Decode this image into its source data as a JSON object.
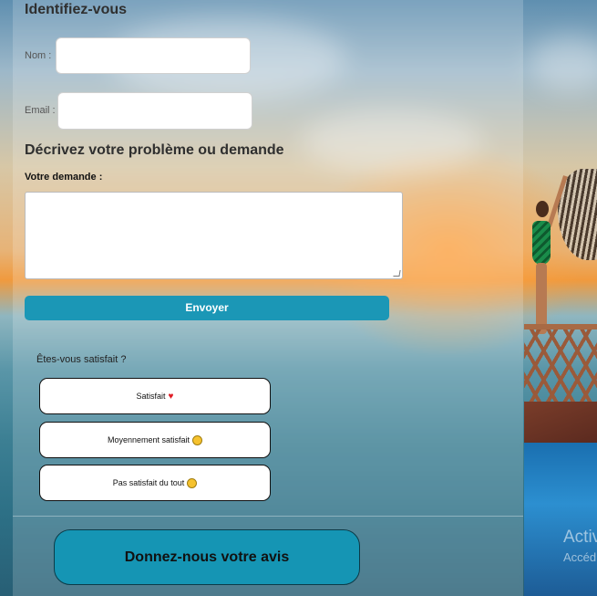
{
  "identify": {
    "title": "Identifiez-vous",
    "name_label": "Nom :",
    "email_label": "Email :",
    "name_value": "",
    "email_value": ""
  },
  "request": {
    "title": "Décrivez votre problème ou demande",
    "label": "Votre demande :",
    "value": "",
    "submit_label": "Envoyer"
  },
  "satisfaction": {
    "question": "Êtes-vous satisfait ?",
    "options": [
      {
        "label": "Satisfait",
        "emoji": "heart-icon"
      },
      {
        "label": "Moyennement satisfait",
        "emoji": "neutral-face-icon"
      },
      {
        "label": "Pas satisfait du tout",
        "emoji": "sad-face-icon"
      }
    ]
  },
  "cta": {
    "label": "Donnez-nous votre avis"
  },
  "watermark": {
    "line1": "Activ",
    "line2": "Accéd"
  },
  "colors": {
    "accent": "#1b97b6",
    "cta": "#1595b4"
  }
}
